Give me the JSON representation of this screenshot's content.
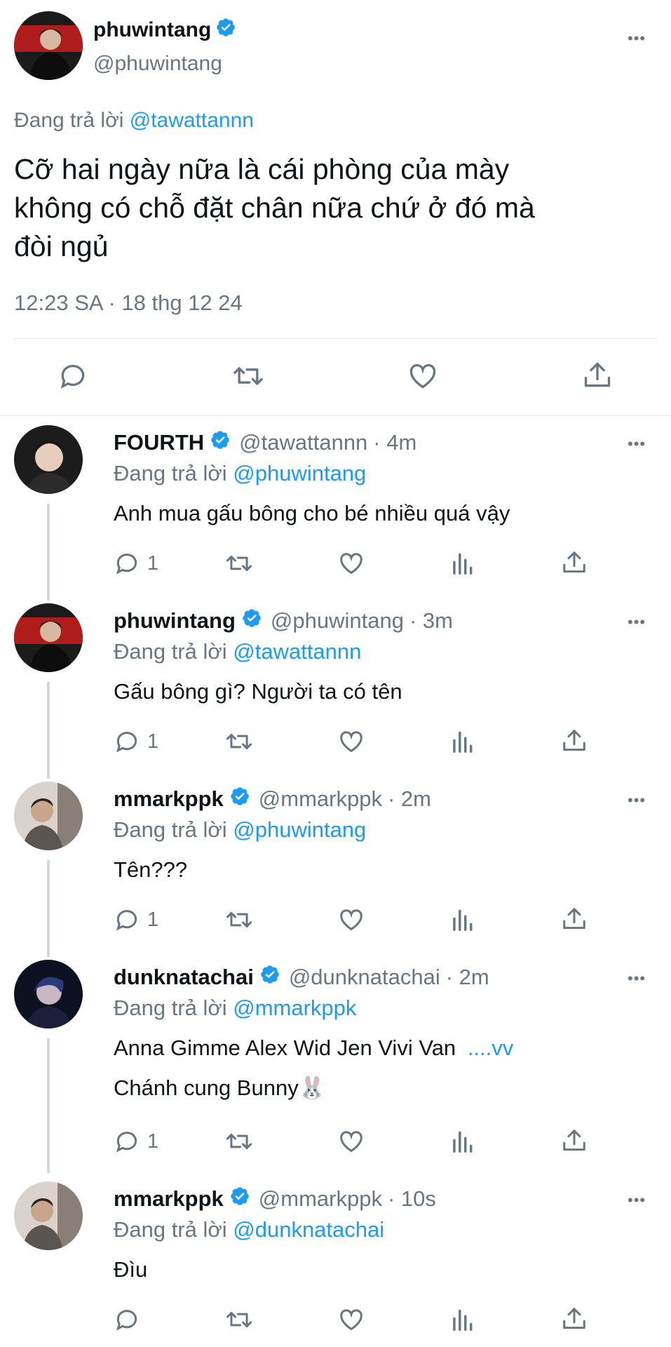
{
  "main_tweet": {
    "display_name": "phuwintang",
    "handle": "@phuwintang",
    "replying_prefix": "Đang trả lời",
    "replying_to": "@tawattannn",
    "text_lines": [
      "Cỡ hai ngày nữa là cái phòng của mày",
      "không có chỗ đặt chân nữa chứ ở đó mà",
      "đòi ngủ"
    ],
    "timestamp": "12:23 SA · 18 thg 12 24"
  },
  "replies": [
    {
      "display_name": "FOURTH",
      "handle": "@tawattannn",
      "time": "· 4m",
      "replying_prefix": "Đang trả lời",
      "replying_to": "@phuwintang",
      "text_lines": [
        "Anh mua gấu bông cho bé nhiều quá vậy"
      ],
      "reply_count": "1"
    },
    {
      "display_name": "phuwintang",
      "handle": "@phuwintang",
      "time": "· 3m",
      "replying_prefix": "Đang trả lời",
      "replying_to": "@tawattannn",
      "text_lines": [
        "Gấu bông gì? Người ta có tên"
      ],
      "reply_count": "1"
    },
    {
      "display_name": "mmarkppk",
      "handle": "@mmarkppk",
      "time": "· 2m",
      "replying_prefix": "Đang trả lời",
      "replying_to": "@phuwintang",
      "text_lines": [
        "Tên???"
      ],
      "reply_count": "1"
    },
    {
      "display_name": "dunknatachai",
      "handle": "@dunknatachai",
      "time": "· 2m",
      "replying_prefix": "Đang trả lời",
      "replying_to": "@mmarkppk",
      "text_lines": [
        "Anna Gimme Alex Wid Jen Vivi Van",
        "Chánh cung Bunny🐰"
      ],
      "continuation": "....vv",
      "reply_count": "1"
    },
    {
      "display_name": "mmarkppk",
      "handle": "@mmarkppk",
      "time": "· 10s",
      "replying_prefix": "Đang trả lời",
      "replying_to": "@dunknatachai",
      "text_lines": [
        "Đìu"
      ],
      "reply_count": ""
    }
  ],
  "more_label": "•••",
  "icons": [
    "reply-icon",
    "retweet-icon",
    "like-icon",
    "analytics-icon",
    "share-icon",
    "verified-icon",
    "more-icon"
  ],
  "colors": {
    "link": "#1d9bf0",
    "muted": "#687684",
    "verified": "#1d9bf0"
  }
}
